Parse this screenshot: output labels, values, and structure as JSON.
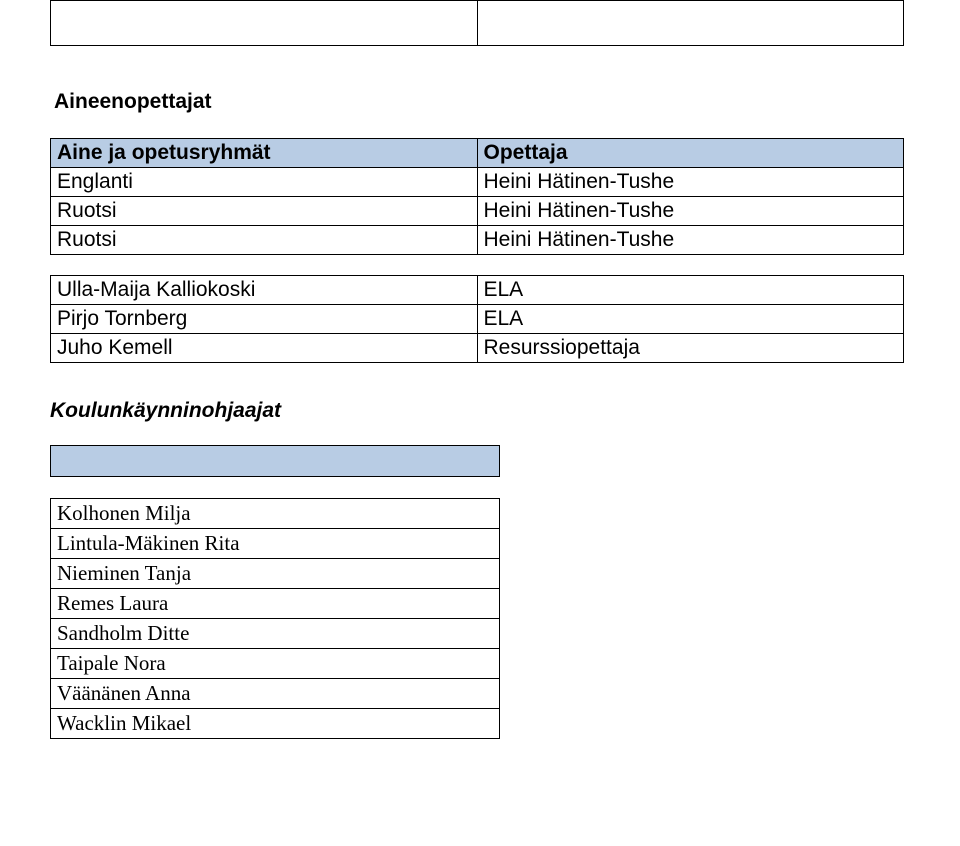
{
  "section1_title": "Aineenopettajat",
  "table1": {
    "header": {
      "col1": "Aine ja opetusryhmät",
      "col2": "Opettaja"
    },
    "rows": [
      {
        "col1": "Englanti",
        "col2": "Heini Hätinen-Tushe"
      },
      {
        "col1": "Ruotsi",
        "col2": "Heini Hätinen-Tushe"
      },
      {
        "col1": "Ruotsi",
        "col2": "Heini Hätinen-Tushe"
      }
    ]
  },
  "table2": {
    "rows": [
      {
        "col1": "Ulla-Maija Kalliokoski",
        "col2": "ELA"
      },
      {
        "col1": "Pirjo Tornberg",
        "col2": "ELA"
      },
      {
        "col1": "Juho Kemell",
        "col2": "Resurssiopettaja"
      }
    ]
  },
  "section2_title": "Koulunkäynninohjaajat",
  "table3": {
    "rows": [
      "Kolhonen Milja",
      "Lintula-Mäkinen Rita",
      "Nieminen Tanja",
      "Remes Laura",
      "Sandholm Ditte",
      "Taipale Nora",
      "Väänänen Anna",
      "Wacklin Mikael"
    ]
  }
}
